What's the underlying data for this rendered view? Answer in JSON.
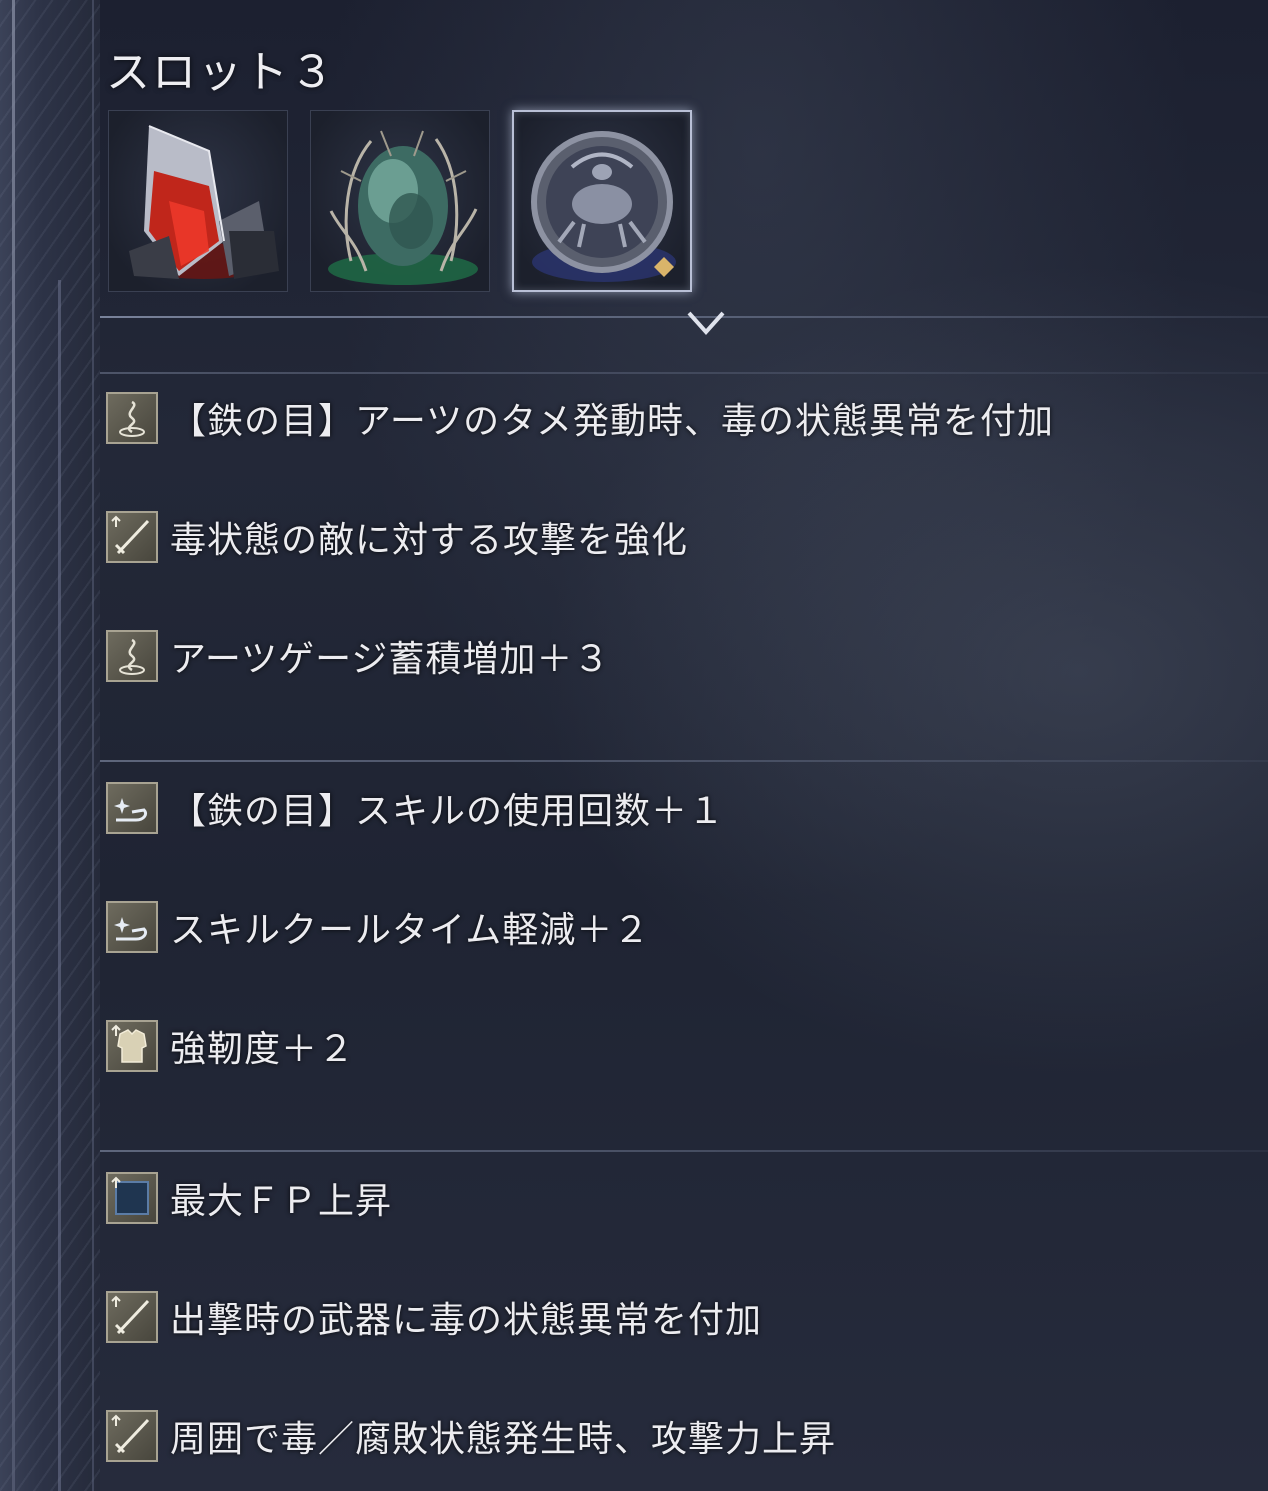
{
  "slot": {
    "title": "スロット３"
  },
  "relics": [
    {
      "name": "red-crystal-relic",
      "icon": "red-crystal-icon",
      "accent": "#d22a1e",
      "selected": false
    },
    {
      "name": "green-egg-relic",
      "icon": "green-egg-icon",
      "accent": "#2f9a6a",
      "selected": false
    },
    {
      "name": "blue-medallion-relic",
      "icon": "blue-medallion-icon",
      "accent": "#3d4f8f",
      "selected": true
    }
  ],
  "effects": [
    {
      "icon": "arts-swirl-icon",
      "text": "【鉄の目】アーツのタメ発動時、毒の状態異常を付加"
    },
    {
      "icon": "sword-icon",
      "text": "毒状態の敵に対する攻撃を強化"
    },
    {
      "icon": "arts-swirl-icon",
      "text": "アーツゲージ蓄積増加＋３"
    },
    {
      "icon": "skill-hand-icon",
      "text": "【鉄の目】スキルの使用回数＋１"
    },
    {
      "icon": "skill-hand-icon",
      "text": "スキルクールタイム軽減＋２"
    },
    {
      "icon": "armor-icon",
      "text": "強靭度＋２"
    },
    {
      "icon": "fp-icon",
      "text": "最大ＦＰ上昇"
    },
    {
      "icon": "sword-icon",
      "text": "出撃時の武器に毒の状態異常を付加"
    },
    {
      "icon": "sword-icon",
      "text": "周囲で毒／腐敗状態発生時、攻撃力上昇"
    }
  ]
}
